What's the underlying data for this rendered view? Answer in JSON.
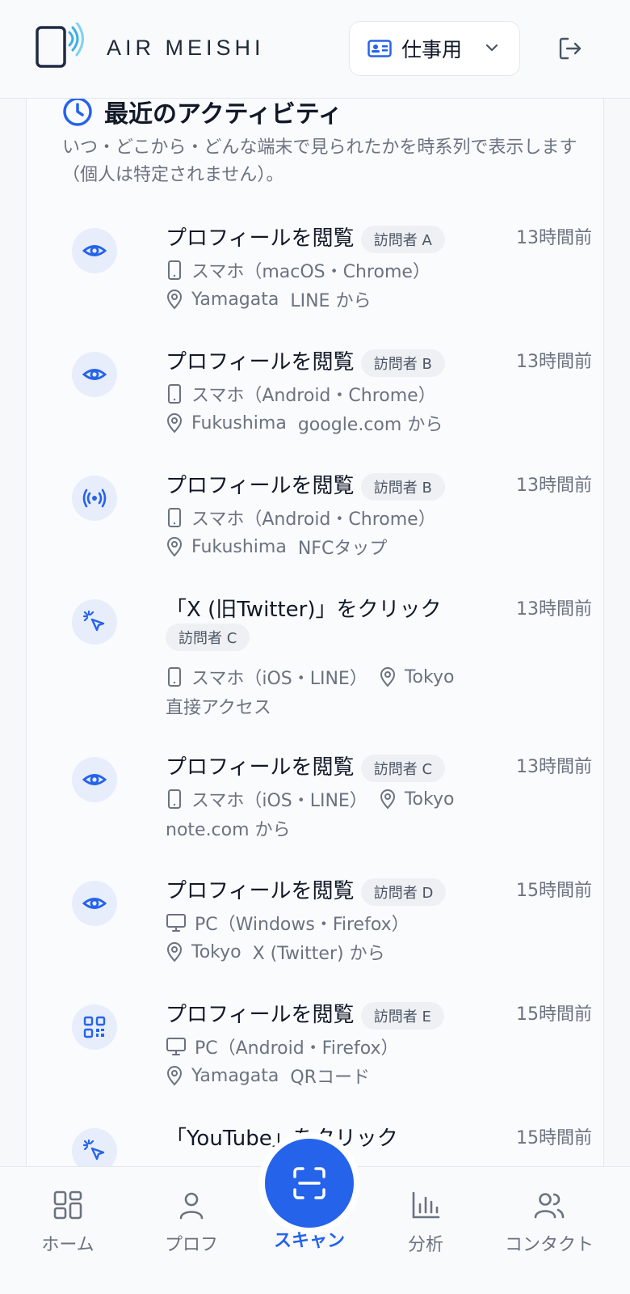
{
  "header": {
    "brand": "AIR MEISHI",
    "profile_label": "仕事用"
  },
  "section": {
    "title": "最近のアクティビティ",
    "description": "いつ・どこから・どんな端末で見られたかを時系列で表示します（個人は特定されません）。"
  },
  "activities": [
    {
      "icon": "eye-icon",
      "title": "プロフィールを閲覧",
      "visitor": "訪問者 A",
      "time": "13時間前",
      "device": "スマホ（macOS・Chrome）",
      "location": "Yamagata",
      "source": "LINE から"
    },
    {
      "icon": "eye-icon",
      "title": "プロフィールを閲覧",
      "visitor": "訪問者 B",
      "time": "13時間前",
      "device": "スマホ（Android・Chrome）",
      "location": "Fukushima",
      "source": "google.com から"
    },
    {
      "icon": "nfc-icon",
      "title": "プロフィールを閲覧",
      "visitor": "訪問者 B",
      "time": "13時間前",
      "device": "スマホ（Android・Chrome）",
      "location": "Fukushima",
      "source": "NFCタップ"
    },
    {
      "icon": "click-icon",
      "title": "「X (旧Twitter)」をクリック",
      "visitor": "訪問者 C",
      "time": "13時間前",
      "device": "スマホ（iOS・LINE）",
      "location": "Tokyo",
      "source": "直接アクセス"
    },
    {
      "icon": "eye-icon",
      "title": "プロフィールを閲覧",
      "visitor": "訪問者 C",
      "time": "13時間前",
      "device": "スマホ（iOS・LINE）",
      "location": "Tokyo",
      "source": "note.com から"
    },
    {
      "icon": "eye-icon",
      "title": "プロフィールを閲覧",
      "visitor": "訪問者 D",
      "time": "15時間前",
      "device": "PC（Windows・Firefox）",
      "location": "Tokyo",
      "source": "X (Twitter) から"
    },
    {
      "icon": "qr-icon",
      "title": "プロフィールを閲覧",
      "visitor": "訪問者 E",
      "time": "15時間前",
      "device": "PC（Android・Firefox）",
      "location": "Yamagata",
      "source": "QRコード"
    },
    {
      "icon": "click-icon",
      "title": "「YouTube」をクリック",
      "visitor": "",
      "time": "15時間前",
      "device": "",
      "location": "",
      "source": ""
    }
  ],
  "nav": {
    "home": "ホーム",
    "profile": "プロフ",
    "scan": "スキャン",
    "analytics": "分析",
    "contacts": "コンタクト"
  },
  "colors": {
    "accent": "#2563eb",
    "icon_bg": "#e8edfb",
    "muted": "#6b7280"
  }
}
